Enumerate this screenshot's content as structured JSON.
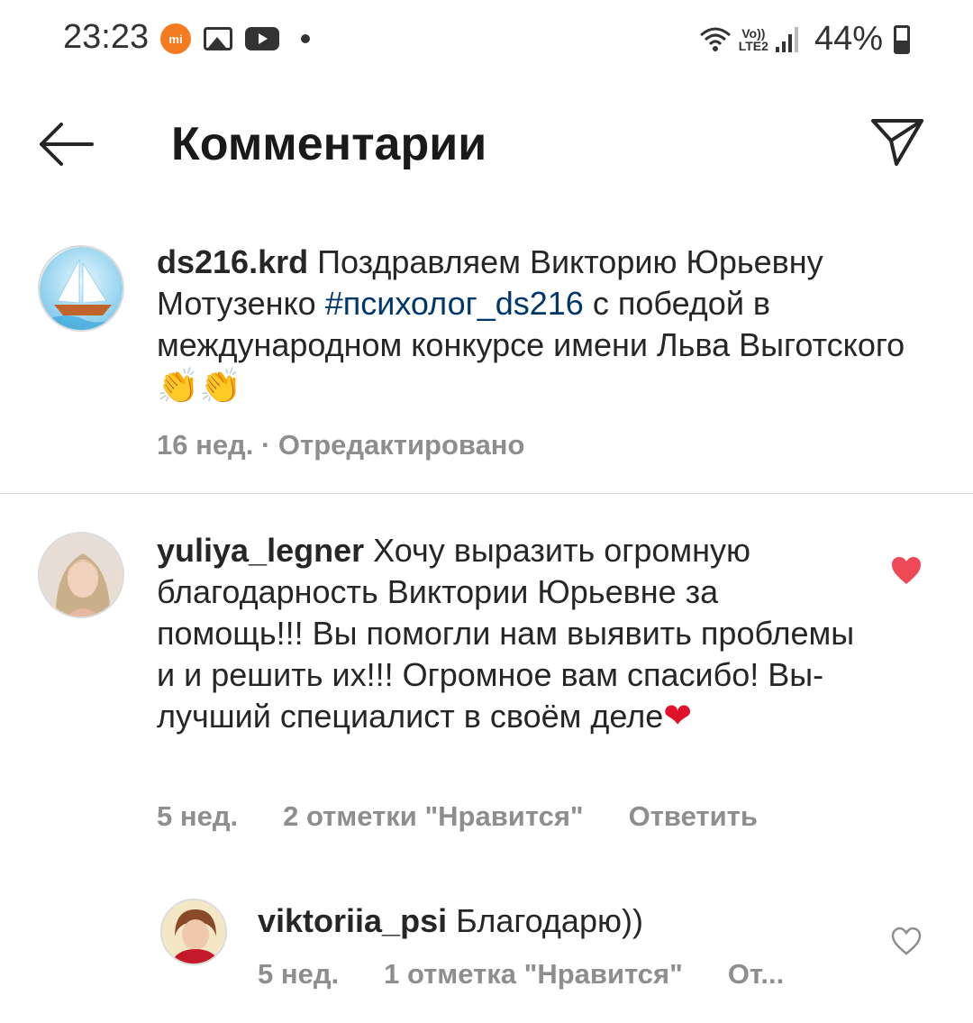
{
  "status_bar": {
    "time": "23:23",
    "mi_label": "mi",
    "network": "Vo))",
    "network_sub": "LTE2",
    "battery_percent": "44%"
  },
  "header": {
    "title": "Комментарии"
  },
  "post_caption": {
    "username": "ds216.krd",
    "text_before_hashtag": " Поздравляем Викторию Юрьевну Мотузенко ",
    "hashtag": "#психолог_ds216",
    "text_after_hashtag": " с победой в международном конкурсе  имени Льва Выготского ",
    "emoji": "👏👏",
    "meta": "16 нед. · Отредактировано"
  },
  "comments": [
    {
      "username": "yuliya_legner",
      "text": " Хочу выразить огромную благодарность Виктории Юрьевне за помощь!!! Вы помогли нам выявить проблемы и и решить их!!! Огромное вам спасибо! Вы-лучший специалист в своём деле",
      "emoji": "❤",
      "time": "5 нед.",
      "likes": "2 отметки \"Нравится\"",
      "reply_label": "Ответить",
      "liked": true,
      "heart_color": "#ed4956"
    }
  ],
  "replies": [
    {
      "username": "viktoriia_psi",
      "text": " Благодарю))",
      "time": "5 нед.",
      "likes": "1 отметка \"Нравится\"",
      "reply_label": "От...",
      "liked": false
    }
  ]
}
